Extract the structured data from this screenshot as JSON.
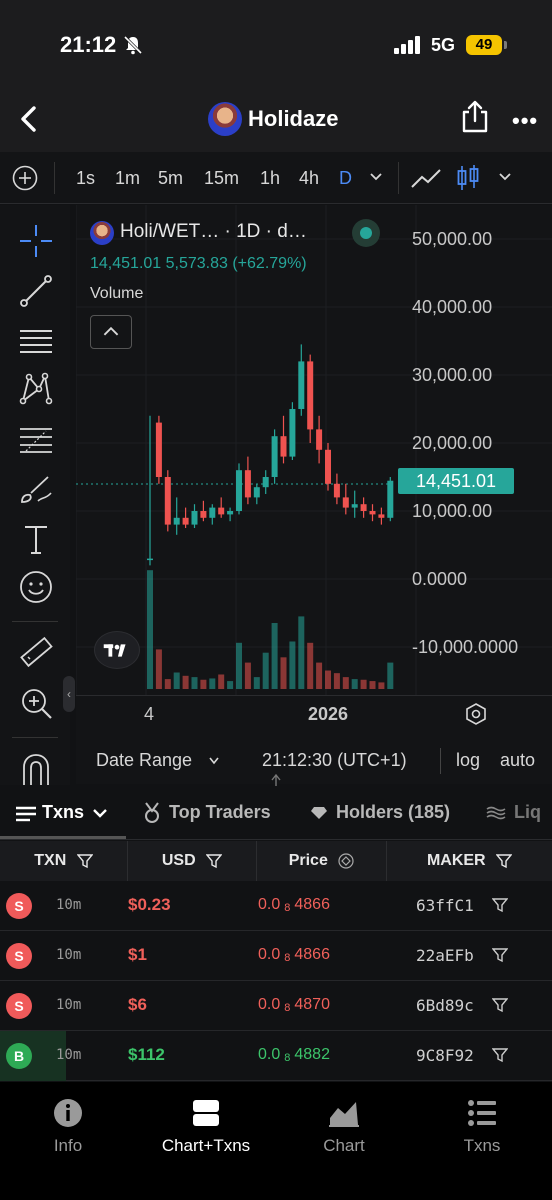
{
  "status_bar": {
    "time": "21:12",
    "network": "5G",
    "battery": "49"
  },
  "header": {
    "title": "Holidaze"
  },
  "timeframes": [
    "1s",
    "1m",
    "5m",
    "15m",
    "1h",
    "4h",
    "D"
  ],
  "active_timeframe": "D",
  "chart": {
    "symbol": "Holi/WET… · 1D · d…",
    "price_line": "14,451.01 5,573.83 (+62.79%)",
    "volume_label": "Volume",
    "last_price_tag": "14,451.01",
    "price_axis": [
      "50,000.00",
      "40,000.00",
      "30,000.00",
      "20,000.00",
      "10,000.00",
      "0.0000",
      "-10,000.0000"
    ],
    "x_axis": {
      "label_1": "4",
      "label_2": "2026"
    },
    "date_range_label": "Date Range",
    "clock": "21:12:30 (UTC+1)",
    "log_label": "log",
    "auto_label": "auto"
  },
  "tabs": {
    "txns": "Txns",
    "top_traders": "Top Traders",
    "holders": "Holders (185)",
    "liquidity": "Liq"
  },
  "table": {
    "headers": {
      "txn": "TXN",
      "usd": "USD",
      "price": "Price",
      "maker": "MAKER"
    },
    "rows": [
      {
        "type": "S",
        "age": "10m",
        "usd": "$0.23",
        "price_lead": "0.0",
        "price_sub": "8",
        "price_tail": "4866",
        "maker": "63ffC1"
      },
      {
        "type": "S",
        "age": "10m",
        "usd": "$1",
        "price_lead": "0.0",
        "price_sub": "8",
        "price_tail": "4866",
        "maker": "22aEFb"
      },
      {
        "type": "S",
        "age": "10m",
        "usd": "$6",
        "price_lead": "0.0",
        "price_sub": "8",
        "price_tail": "4870",
        "maker": "6Bd89c"
      },
      {
        "type": "B",
        "age": "10m",
        "usd": "$112",
        "price_lead": "0.0",
        "price_sub": "8",
        "price_tail": "4882",
        "maker": "9C8F92"
      }
    ]
  },
  "bottom_nav": {
    "info": "Info",
    "chart_txns": "Chart+Txns",
    "chart": "Chart",
    "txns": "Txns"
  },
  "colors": {
    "up": "#26a69a",
    "down": "#ef5350",
    "sell_badge": "#f05a5a",
    "buy_badge": "#2eaa55",
    "accent": "#4c8bf5"
  }
}
